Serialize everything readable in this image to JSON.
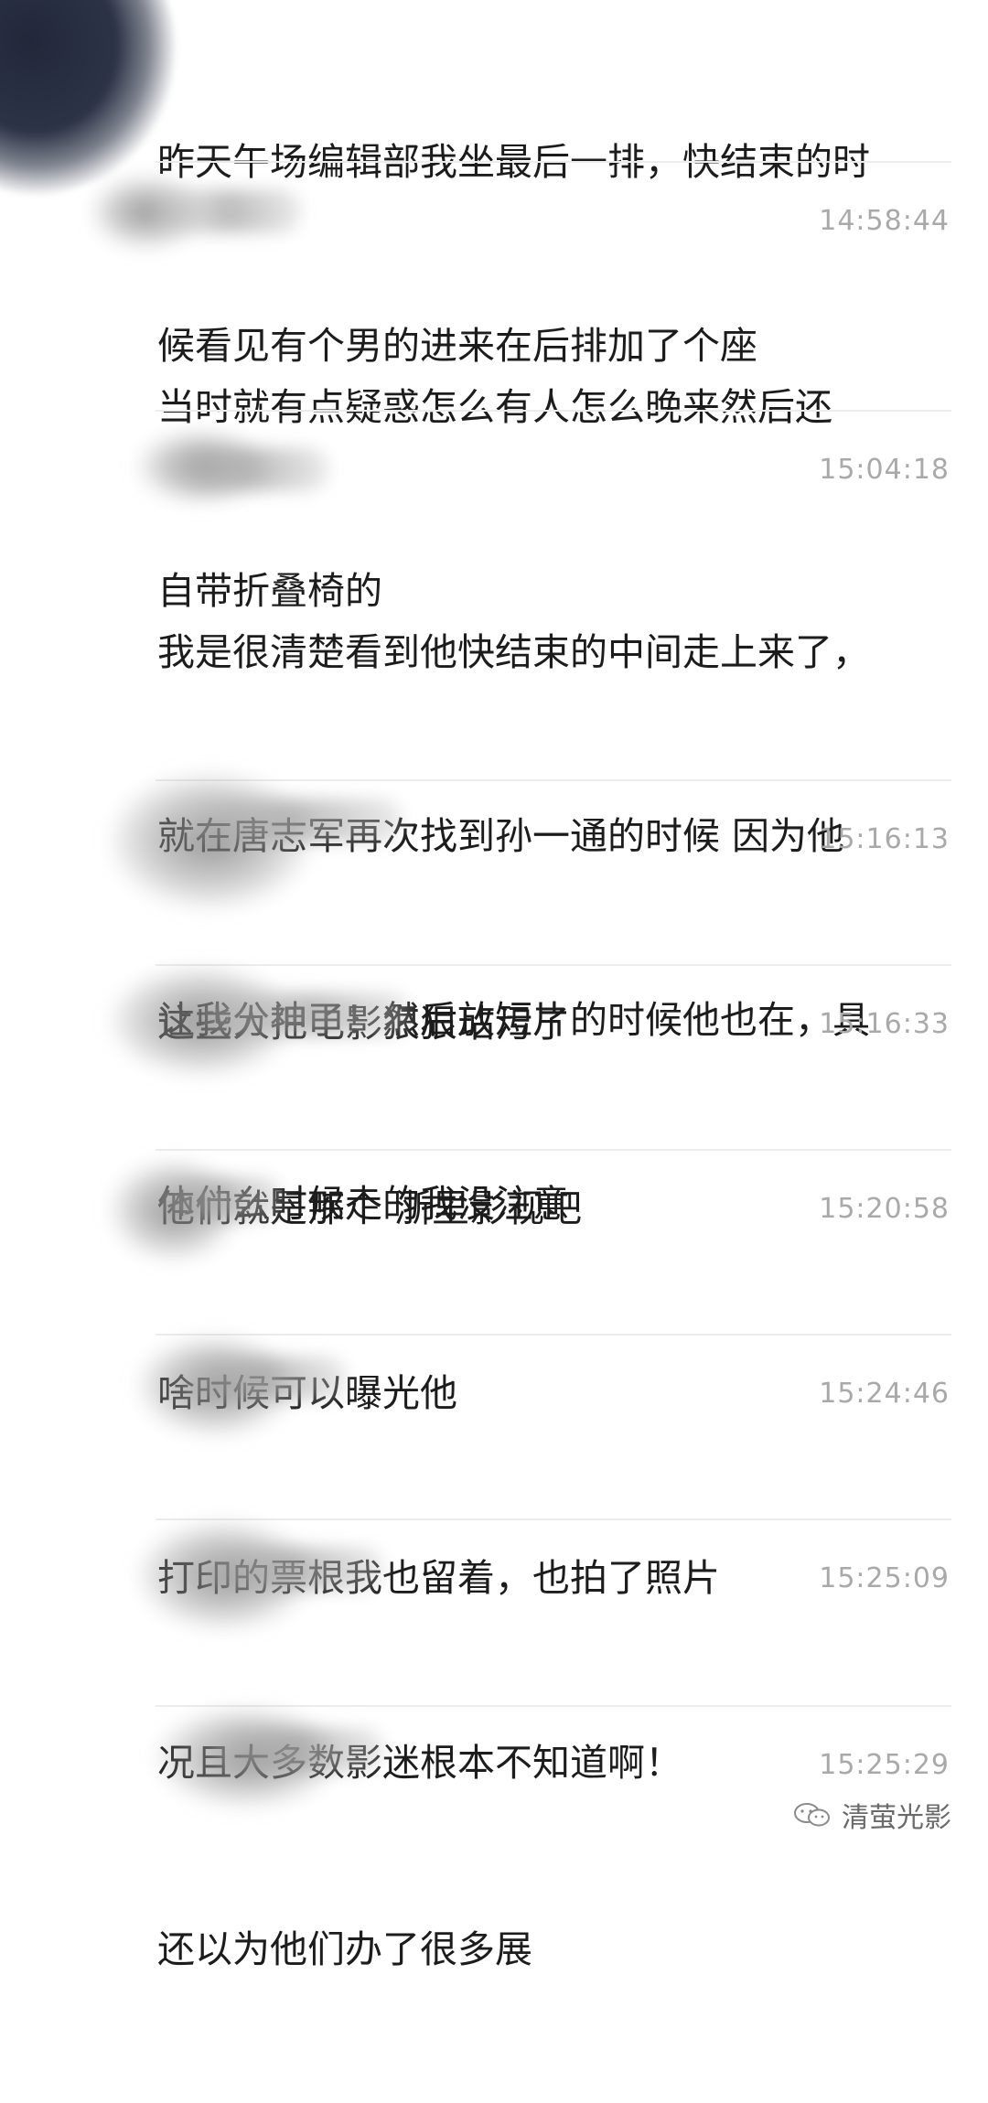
{
  "messages": [
    {
      "time": "",
      "lines": [
        "昨天午场编辑部我坐最后一排，快结束的时",
        "候看见有个男的进来在后排加了个座"
      ]
    },
    {
      "time": "14:58:44",
      "lines": [
        "当时就有点疑惑怎么有人怎么晚来然后还",
        "自带折叠椅的"
      ]
    },
    {
      "time": "15:04:18",
      "lines": [
        "我是很清楚看到他快结束的中间走上来了，",
        "就在唐志军再次找到孙一通的时候 因为他",
        "让我分神了！然后放短片的时候他也在，具",
        "体什么时候走的我没注意"
      ]
    },
    {
      "time": "15:16:13",
      "lines": [
        "这些人把电影狠狠玷污了"
      ]
    },
    {
      "time": "15:16:33",
      "lines": [
        "他们就是那个 浙里影视吧"
      ]
    },
    {
      "time": "15:20:58",
      "lines": [
        "啥时候可以曝光他"
      ]
    },
    {
      "time": "15:24:46",
      "lines": [
        "打印的票根我也留着，也拍了照片"
      ]
    },
    {
      "time": "15:25:09",
      "lines": [
        "况且大多数影迷根本不知道啊！"
      ]
    },
    {
      "time": "15:25:29",
      "lines": [
        "还以为他们办了很多展"
      ]
    }
  ],
  "watermark": {
    "text": "清萤光影",
    "icon": "wechat-official-account-icon"
  }
}
